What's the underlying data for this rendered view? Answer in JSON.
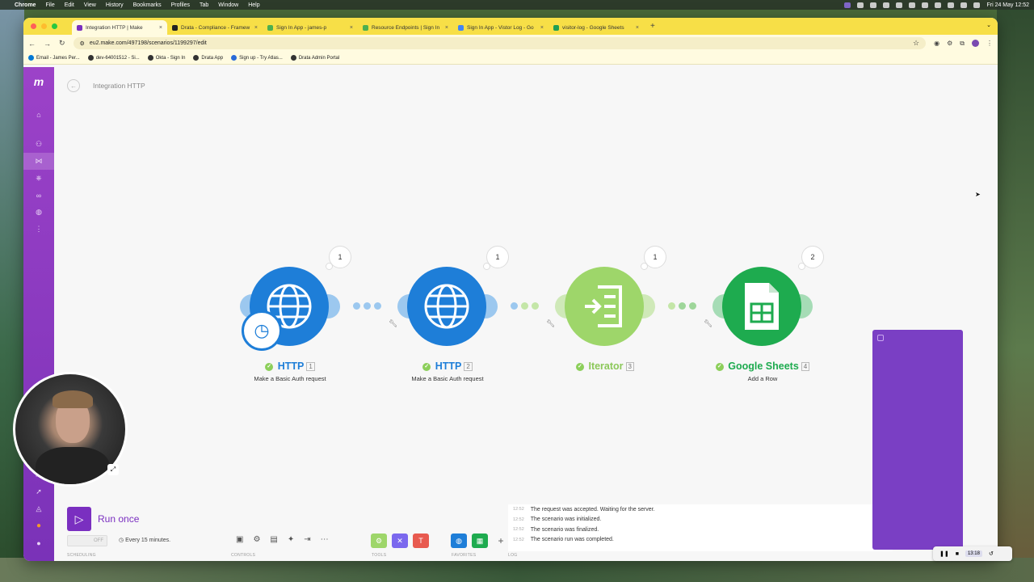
{
  "menubar": {
    "app": "Chrome",
    "items": [
      "File",
      "Edit",
      "View",
      "History",
      "Bookmarks",
      "Profiles",
      "Tab",
      "Window",
      "Help"
    ],
    "datetime": "Fri 24 May  12:52"
  },
  "browser": {
    "tabs": [
      {
        "title": "Integration HTTP | Make",
        "color": "#7a2fc0"
      },
      {
        "title": "Drata - Compliance - Framew",
        "color": "#222222"
      },
      {
        "title": "Sign In App - james-p",
        "color": "#4caf50"
      },
      {
        "title": "Resource Endpoints | Sign In",
        "color": "#4caf50"
      },
      {
        "title": "Sign In App - Vistor Log - Go",
        "color": "#4285f4"
      },
      {
        "title": "visitor-log - Google Sheets",
        "color": "#1e9e54"
      }
    ],
    "new_tab": "+",
    "url": "eu2.make.com/497198/scenarios/1199297/edit",
    "bookmarks": [
      "Email - James Per...",
      "dev-64001512 - Si...",
      "Okta - Sign In",
      "Drata App",
      "Sign up - Try Atlas...",
      "Drata Admin Portal"
    ]
  },
  "scenario": {
    "title": "Integration HTTP",
    "modules": [
      {
        "name": "HTTP",
        "number": "1",
        "desc": "Make a Basic Auth request",
        "bubble": "1",
        "color": "#1e7ed8",
        "icon": "globe-icon"
      },
      {
        "name": "HTTP",
        "number": "2",
        "desc": "Make a Basic Auth request",
        "bubble": "1",
        "color": "#1e7ed8",
        "icon": "globe-icon"
      },
      {
        "name": "Iterator",
        "number": "3",
        "desc": "",
        "bubble": "1",
        "color": "#9ed66a",
        "icon": "iterator-icon"
      },
      {
        "name": "Google Sheets",
        "number": "4",
        "desc": "Add a Row",
        "bubble": "2",
        "color": "#1eab4f",
        "icon": "sheets-icon"
      }
    ]
  },
  "bottom": {
    "run_label": "Run once",
    "toggle": "OFF",
    "schedule": "Every 15 minutes.",
    "groups": {
      "scheduling": "SCHEDULING",
      "controls": "CONTROLS",
      "tools": "TOOLS",
      "favorites": "FAVORITES",
      "log": "LOG"
    },
    "log": [
      {
        "time": "12:52",
        "text": "The request was accepted. Waiting for the server."
      },
      {
        "time": "12:52",
        "text": "The scenario was initialized."
      },
      {
        "time": "12:52",
        "text": "The scenario was finalized."
      },
      {
        "time": "12:52",
        "text": "The scenario run was completed."
      }
    ]
  },
  "recorder": {
    "time": "13:18"
  }
}
